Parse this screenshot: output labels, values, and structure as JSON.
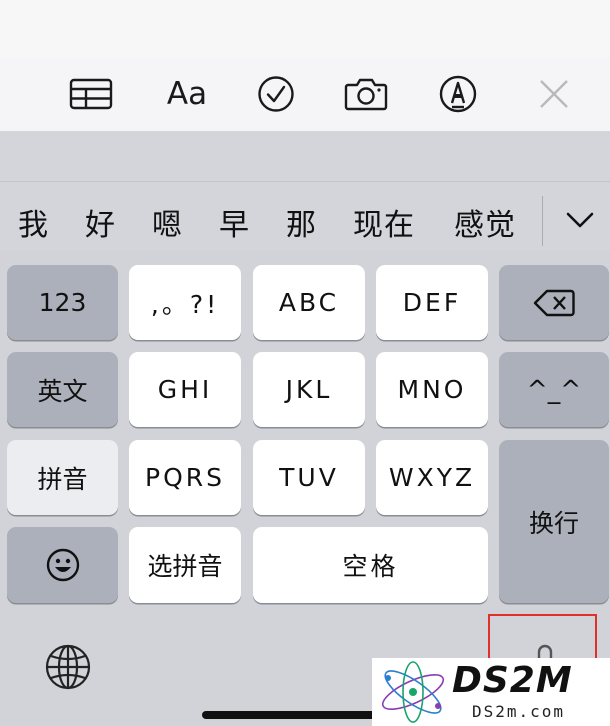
{
  "toolbar": {
    "table_icon": "table-icon",
    "format_label": "Aa",
    "checklist_icon": "checkmark-circle-icon",
    "camera_icon": "camera-icon",
    "markup_icon": "pen-circle-icon",
    "close_icon": "close-icon"
  },
  "candidates": {
    "items": [
      "我",
      "好",
      "嗯",
      "早",
      "那",
      "现在",
      "感觉"
    ],
    "expand_icon": "chevron-down-icon"
  },
  "keys": {
    "numbers": "123",
    "punct": ",。?!",
    "abc": "ABC",
    "def": "DEF",
    "english": "英文",
    "ghi": "GHI",
    "jkl": "JKL",
    "mno": "MNO",
    "emoticon": "^_^",
    "pinyin": "拼音",
    "pqrs": "PQRS",
    "tuv": "TUV",
    "wxyz": "WXYZ",
    "return": "换行",
    "select_pinyin": "选拼音",
    "space": "空格",
    "delete_icon": "delete-backspace-icon",
    "emoji_icon": "smiley-icon"
  },
  "bottom": {
    "globe_icon": "globe-icon",
    "mic_icon": "microphone-icon"
  },
  "watermark": {
    "brand": "DS2M",
    "url": "DS2m.com"
  },
  "colors": {
    "keyboard_bg": "#d1d3d9",
    "white_key": "#ffffff",
    "gray_key": "#acb0ba",
    "highlight_box": "#e0302c"
  }
}
